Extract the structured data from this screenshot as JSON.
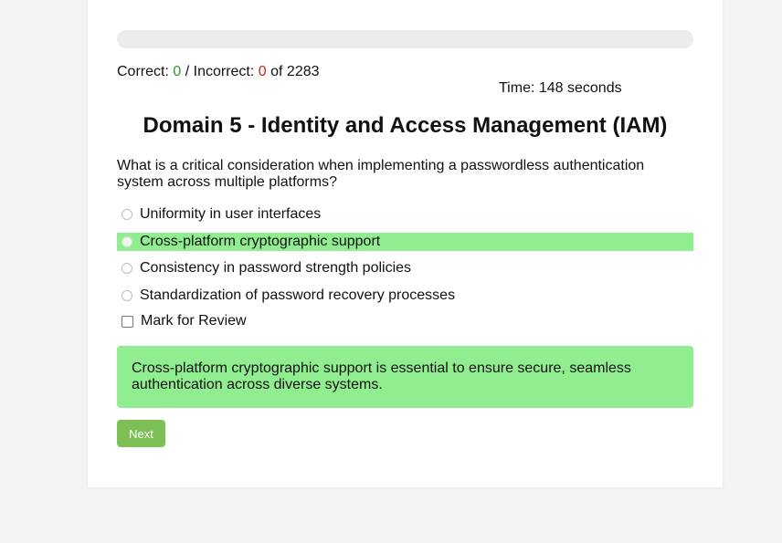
{
  "progress": {
    "fraction": 0.0
  },
  "score": {
    "correct_label": "Correct:",
    "correct_value": "0",
    "separator": "/",
    "incorrect_label": "Incorrect:",
    "incorrect_value": "0",
    "of_label": "of",
    "total": "2283"
  },
  "timer": {
    "text": "Time: 148 seconds"
  },
  "domain_title": "Domain 5 - Identity and Access Management (IAM)",
  "question": "What is a critical consideration when implementing a passwordless authentication system across multiple platforms?",
  "options": [
    {
      "label": "Uniformity in user interfaces"
    },
    {
      "label": "Cross-platform cryptographic support"
    },
    {
      "label": "Consistency in password strength policies"
    },
    {
      "label": "Standardization of password recovery processes"
    }
  ],
  "review": {
    "label": "Mark for Review"
  },
  "explanation": "Cross-platform cryptographic support is essential to ensure secure, seamless authentication across diverse systems.",
  "next_button": {
    "label": "Next"
  },
  "colors": {
    "correct_highlight": "#90ee90",
    "correct_count": "#2a9a2a",
    "incorrect_count": "#d42020",
    "button": "#7bbf55"
  }
}
